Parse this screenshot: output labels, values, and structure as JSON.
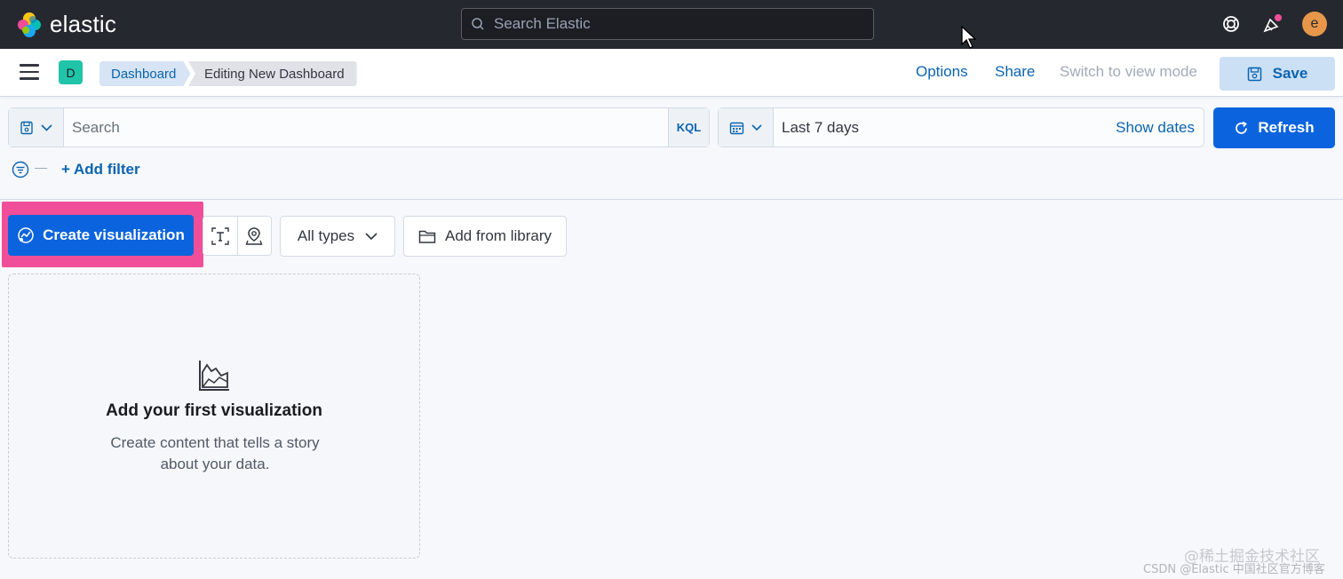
{
  "header": {
    "brand": "elastic",
    "search_placeholder": "Search Elastic",
    "avatar_initial": "e"
  },
  "subheader": {
    "space_initial": "D",
    "breadcrumbs": [
      "Dashboard",
      "Editing New Dashboard"
    ],
    "options_label": "Options",
    "share_label": "Share",
    "switch_label": "Switch to view mode",
    "save_label": "Save"
  },
  "query": {
    "search_placeholder": "Search",
    "language": "KQL",
    "time_range": "Last 7 days",
    "show_dates_label": "Show dates",
    "refresh_label": "Refresh",
    "add_filter_label": "+ Add filter"
  },
  "toolbar": {
    "create_label": "Create visualization",
    "types_label": "All types",
    "library_label": "Add from library"
  },
  "empty_state": {
    "title": "Add your first visualization",
    "description": "Create content that tells a story about your data."
  },
  "watermark": {
    "line1": "@稀土掘金技术社区",
    "line2": "CSDN @Elastic 中国社区官方博客"
  },
  "colors": {
    "header_bg": "#25282f",
    "primary": "#0b64dd",
    "highlight": "#f04e98",
    "link": "#0b64b0"
  }
}
